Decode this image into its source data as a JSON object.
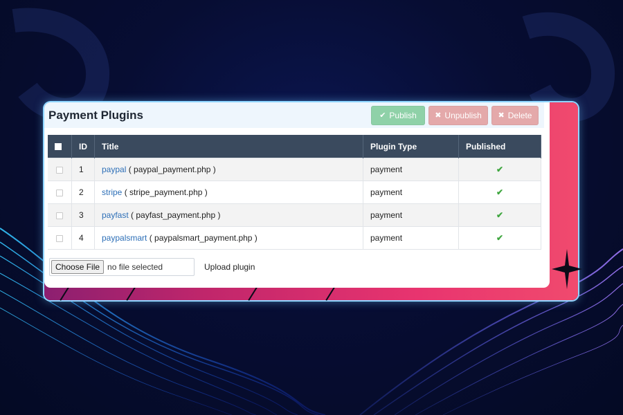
{
  "panel": {
    "title": "Payment Plugins",
    "buttons": {
      "publish": "Publish",
      "unpublish": "Unpublish",
      "delete": "Delete"
    }
  },
  "table": {
    "headers": {
      "id": "ID",
      "title": "Title",
      "type": "Plugin Type",
      "published": "Published"
    },
    "rows": [
      {
        "id": "1",
        "name": "paypal",
        "file": "( paypal_payment.php )",
        "type": "payment",
        "published": true
      },
      {
        "id": "2",
        "name": "stripe",
        "file": "( stripe_payment.php )",
        "type": "payment",
        "published": true
      },
      {
        "id": "3",
        "name": "payfast",
        "file": "( payfast_payment.php )",
        "type": "payment",
        "published": true
      },
      {
        "id": "4",
        "name": "paypalsmart",
        "file": "( paypalsmart_payment.php )",
        "type": "payment",
        "published": true
      }
    ]
  },
  "upload": {
    "choose_label": "Choose File",
    "no_file": "no file selected",
    "upload_label": "Upload plugin"
  },
  "icons": {
    "publish": "check-icon",
    "unpublish": "x-icon",
    "delete": "x-icon",
    "published": "check-icon"
  },
  "colors": {
    "header_bg": "#3a4a5e",
    "publish_btn": "#8fd1a8",
    "unpublish_btn": "#e4a9aa",
    "link": "#2d6fb7",
    "check": "#3fa63f",
    "card_accent": "#e8346f"
  }
}
